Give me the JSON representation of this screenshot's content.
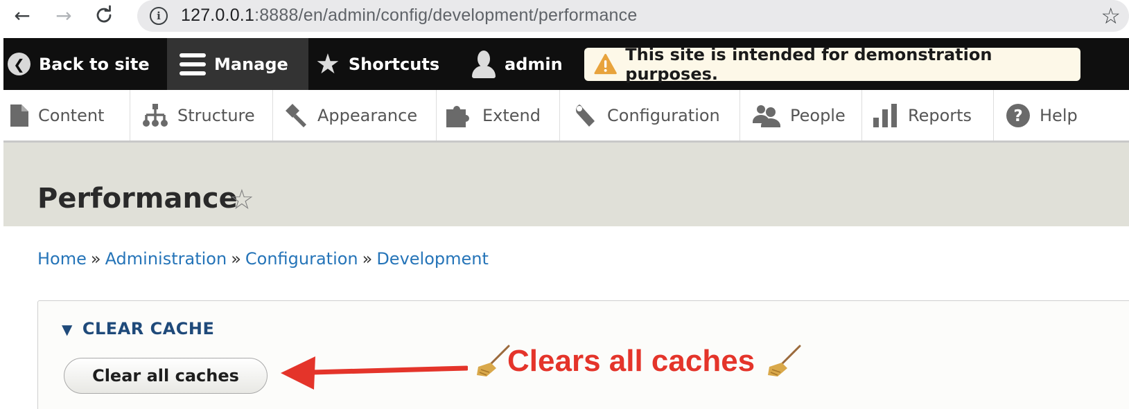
{
  "browser": {
    "url_host": "127.0.0.1",
    "url_rest": ":8888/en/admin/config/development/performance",
    "icons": {
      "back": "arrow-left-icon",
      "forward": "arrow-right-icon",
      "reload": "reload-icon",
      "info": "info-icon",
      "bookmark": "star-outline-icon"
    }
  },
  "toolbar": {
    "back_to_site": "Back to site",
    "manage": "Manage",
    "shortcuts": "Shortcuts",
    "user": "admin",
    "demo_notice": "This site is intended for demonstration purposes."
  },
  "admin_menu": {
    "items": [
      {
        "label": "Content",
        "icon": "content-file-icon"
      },
      {
        "label": "Structure",
        "icon": "structure-icon"
      },
      {
        "label": "Appearance",
        "icon": "appearance-brush-icon"
      },
      {
        "label": "Extend",
        "icon": "extend-puzzle-icon"
      },
      {
        "label": "Configuration",
        "icon": "wrench-icon"
      },
      {
        "label": "People",
        "icon": "people-icon"
      },
      {
        "label": "Reports",
        "icon": "reports-bar-icon"
      },
      {
        "label": "Help",
        "icon": "help-question-icon"
      }
    ]
  },
  "page": {
    "title": "Performance"
  },
  "breadcrumb": {
    "items": [
      "Home",
      "Administration",
      "Configuration",
      "Development"
    ],
    "separator": "»"
  },
  "clear_cache": {
    "legend": "CLEAR CACHE",
    "button_label": "Clear all caches"
  },
  "annotation": {
    "text": "Clears all caches",
    "color": "#e4342a"
  },
  "colors": {
    "toolbar_bg": "#0f0f0f",
    "link": "#2574b8",
    "legend": "#1f4a7a",
    "header_bg": "#e0e0d8",
    "banner_bg": "#fdf8e8"
  }
}
